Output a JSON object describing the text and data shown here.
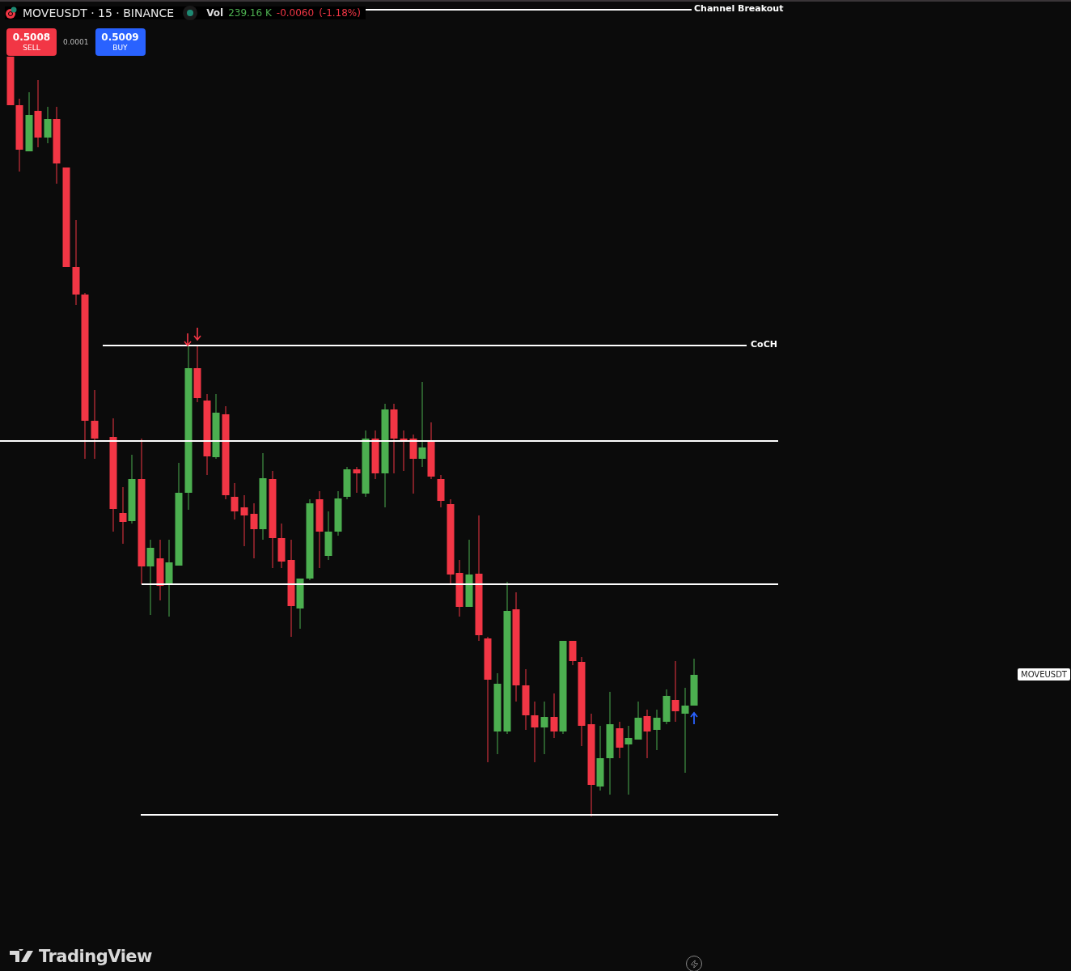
{
  "legend": {
    "symbol": "MOVEUSDT · 15 · BINANCE",
    "volume_label": "Vol",
    "volume": "239.16 K",
    "change": "-0.0060",
    "change_percent": "(-1.18%)"
  },
  "trade": {
    "sell_price": "0.5008",
    "sell_label": "SELL",
    "spread": "0.0001",
    "buy_price": "0.5009",
    "buy_label": "BUY"
  },
  "lines": [
    {
      "label": "Channel Breakout"
    },
    {
      "label": "CoCH"
    }
  ],
  "symbol_tag": "MOVEUSDT",
  "logo": "TradingView"
}
